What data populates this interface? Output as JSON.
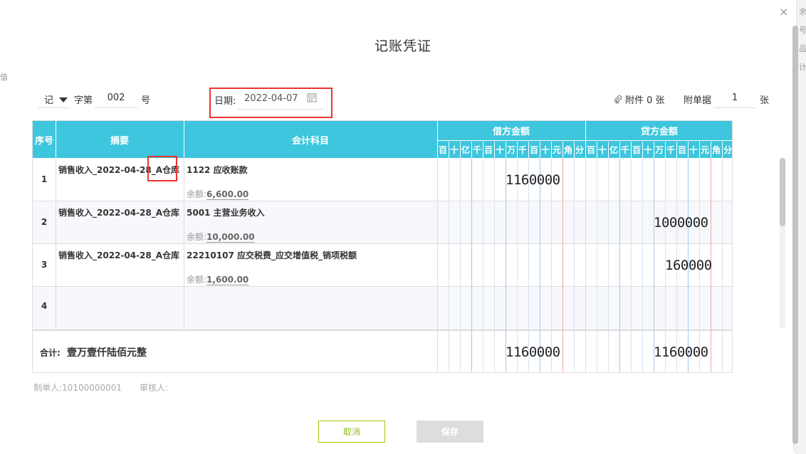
{
  "dialog": {
    "title": "记账凭证",
    "close_glyph": "×"
  },
  "header": {
    "voucher_type": "记",
    "zi_label": "字第",
    "voucher_no": "002",
    "hao_label": "号",
    "date_label": "日期:",
    "date_value": "2022-04-07",
    "attachment_label": "附件 0 张",
    "receipt_label": "附单据",
    "receipt_count": "1",
    "zhang_label": "张"
  },
  "table": {
    "col_seq": "序号",
    "col_summary": "摘要",
    "col_account": "会计科目",
    "col_debit": "借方金额",
    "col_credit": "贷方金额",
    "digit_labels": [
      "百",
      "十",
      "亿",
      "千",
      "百",
      "十",
      "万",
      "千",
      "百",
      "十",
      "元",
      "角",
      "分"
    ],
    "rows": [
      {
        "no": "1",
        "summary": "销售收入_2022-04-28_A仓库",
        "account": "1122 应收账款",
        "balance_label": "余额:",
        "balance": "6,600.00",
        "debit": "1160000",
        "credit": ""
      },
      {
        "no": "2",
        "summary": "销售收入_2022-04-28_A仓库",
        "account": "5001 主营业务收入",
        "balance_label": "余额:",
        "balance": "10,000.00",
        "debit": "",
        "credit": "1000000"
      },
      {
        "no": "3",
        "summary": "销售收入_2022-04-28_A仓库",
        "account": "22210107 应交税费_应交增值税_销项税额",
        "balance_label": "余额:",
        "balance": "1,600.00",
        "debit": "",
        "credit": "160000"
      },
      {
        "no": "4",
        "summary": "",
        "account": "",
        "balance_label": "",
        "balance": "",
        "debit": "",
        "credit": ""
      }
    ],
    "total_label": "合计:",
    "total_words": "壹万壹仟陆佰元整",
    "total_debit": "1160000",
    "total_credit": "1160000"
  },
  "footer": {
    "maker": "制单人:10100000001",
    "reviewer": "审核人:"
  },
  "buttons": {
    "cancel": "取消",
    "save": "保存"
  },
  "background": {
    "right_chars": [
      "余",
      "号",
      "品",
      "计"
    ],
    "left_char": "值"
  },
  "colors": {
    "header_bg": "#3dc6dd",
    "highlight": "#e33333",
    "cancel_border": "#99cc00"
  }
}
